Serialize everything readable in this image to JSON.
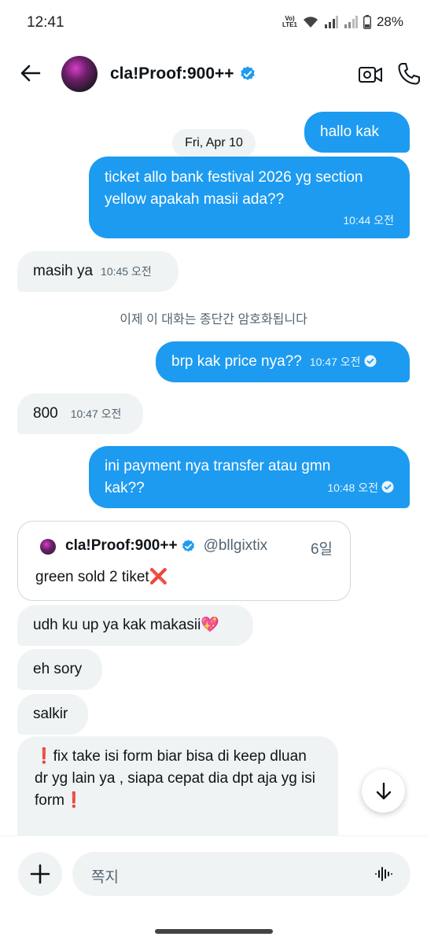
{
  "status_bar": {
    "time": "12:41",
    "volte_top": "Vo)",
    "volte_bottom": "LTE1",
    "battery": "28%"
  },
  "header": {
    "name": "cla!Proof:900++",
    "icons": [
      "back-arrow-icon",
      "verified-badge-icon",
      "video-call-icon",
      "phone-icon"
    ]
  },
  "messages": {
    "date_separator": "Fri, Apr 10",
    "m1": {
      "text": "hallo kak"
    },
    "m2": {
      "text": "ticket allo bank festival 2026 yg section yellow apakah masii ada??",
      "time": "10:44 오전"
    },
    "m3": {
      "text": "masih ya",
      "time": "10:45 오전"
    },
    "system_note": "이제 이 대화는 종단간 암호화됩니다",
    "m4": {
      "text": "brp kak price nya??",
      "time": "10:47 오전"
    },
    "m5": {
      "text": "800",
      "time": "10:47 오전"
    },
    "m6": {
      "text": "ini payment nya transfer atau gmn kak??",
      "time": "10:48 오전"
    },
    "quoted_post": {
      "name": "cla!Proof:900++",
      "handle": "@bllgixtix",
      "age": "6일",
      "text": "green sold 2 tiket❌"
    },
    "m7": {
      "text": "udh ku up ya kak makasii💖"
    },
    "m8": {
      "text": "eh sory"
    },
    "m9": {
      "text": "salkir"
    },
    "m10": {
      "text": "❗fix take isi form biar bisa di keep dluan dr yg lain ya , siapa cepat dia dpt aja yg isi form❗"
    }
  },
  "composer": {
    "placeholder": "쪽지"
  },
  "colors": {
    "accent": "#1d9bf0",
    "incoming_bubble": "#eff3f4",
    "secondary_text": "#536471"
  }
}
